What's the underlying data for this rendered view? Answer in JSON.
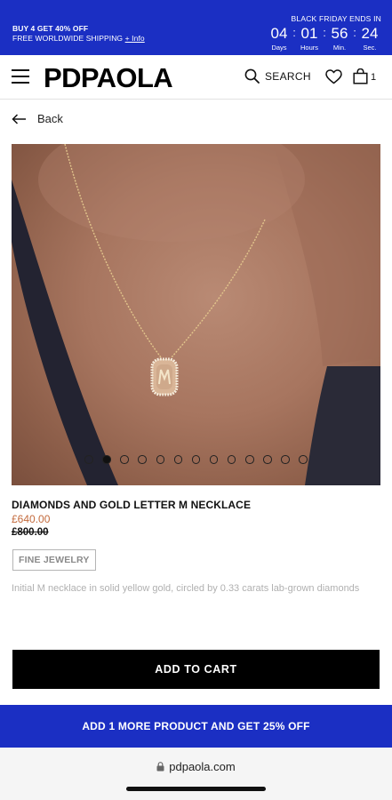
{
  "promo_bar": {
    "line1": "BUY 4 GET 40% OFF",
    "line2": "FREE WORLDWIDE SHIPPING",
    "info_link": "+ Info",
    "countdown_title": "BLACK FRIDAY ENDS IN",
    "countdown": [
      {
        "value": "04",
        "label": "Days"
      },
      {
        "value": "01",
        "label": "Hours"
      },
      {
        "value": "56",
        "label": "Min."
      },
      {
        "value": "24",
        "label": "Sec."
      }
    ],
    "background": "#1b2fc3"
  },
  "header": {
    "logo": "PDPAOLA",
    "search_label": "SEARCH",
    "cart_count": "1",
    "icons": [
      "menu-icon",
      "search-icon",
      "heart-icon",
      "bag-icon"
    ]
  },
  "nav": {
    "back_label": "Back"
  },
  "gallery": {
    "image_alt": "necklace-on-model",
    "dot_count": 13,
    "active_index": 1
  },
  "product": {
    "title": "DIAMONDS AND GOLD LETTER M NECKLACE",
    "price": "£640.00",
    "old_price": "£800.00",
    "price_color": "#c36a3c",
    "tag": "FINE JEWELRY",
    "description": "Initial M necklace in solid yellow gold, circled by 0.33 carats lab-grown diamonds"
  },
  "actions": {
    "add_to_cart": "ADD TO CART"
  },
  "bottom_promo": {
    "text": "ADD 1 MORE PRODUCT AND GET 25% OFF"
  },
  "browser": {
    "url": "pdpaola.com"
  }
}
